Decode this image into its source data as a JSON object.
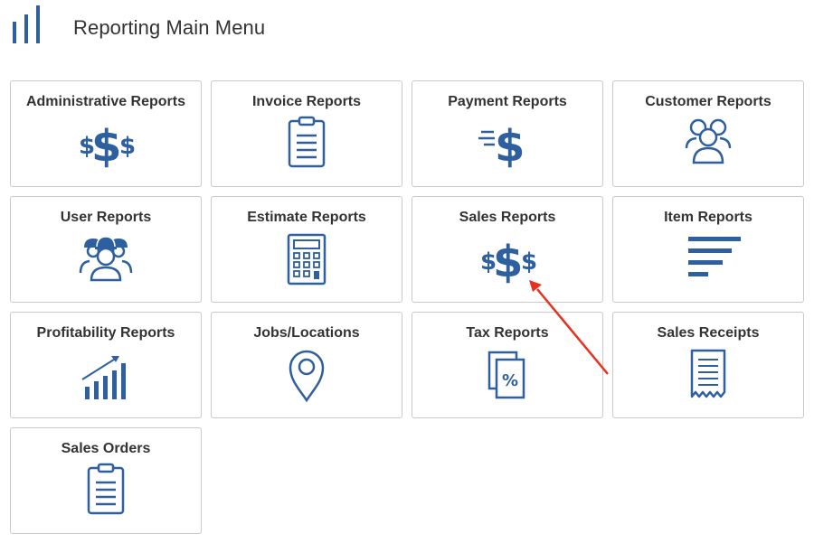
{
  "header": {
    "title": "Reporting Main Menu",
    "icon": "bar-chart-icon"
  },
  "colors": {
    "icon_blue": "#2e5f9e",
    "tile_border": "#c9c9c9",
    "arrow_red": "#e8301e"
  },
  "tiles": [
    {
      "label": "Administrative Reports",
      "icon": "dollar-signs-icon"
    },
    {
      "label": "Invoice Reports",
      "icon": "clipboard-icon"
    },
    {
      "label": "Payment Reports",
      "icon": "fast-dollar-icon"
    },
    {
      "label": "Customer Reports",
      "icon": "customers-group-icon"
    },
    {
      "label": "User Reports",
      "icon": "workers-hardhat-icon"
    },
    {
      "label": "Estimate Reports",
      "icon": "calculator-icon"
    },
    {
      "label": "Sales Reports",
      "icon": "dollar-signs-icon"
    },
    {
      "label": "Item Reports",
      "icon": "horizontal-lines-icon"
    },
    {
      "label": "Profitability Reports",
      "icon": "growth-chart-icon"
    },
    {
      "label": "Jobs/Locations",
      "icon": "map-pin-icon"
    },
    {
      "label": "Tax Reports",
      "icon": "tax-percent-icon"
    },
    {
      "label": "Sales Receipts",
      "icon": "receipt-icon"
    },
    {
      "label": "Sales Orders",
      "icon": "clipboard-icon"
    }
  ],
  "annotation": {
    "type": "arrow",
    "points_to": "Sales Reports"
  }
}
